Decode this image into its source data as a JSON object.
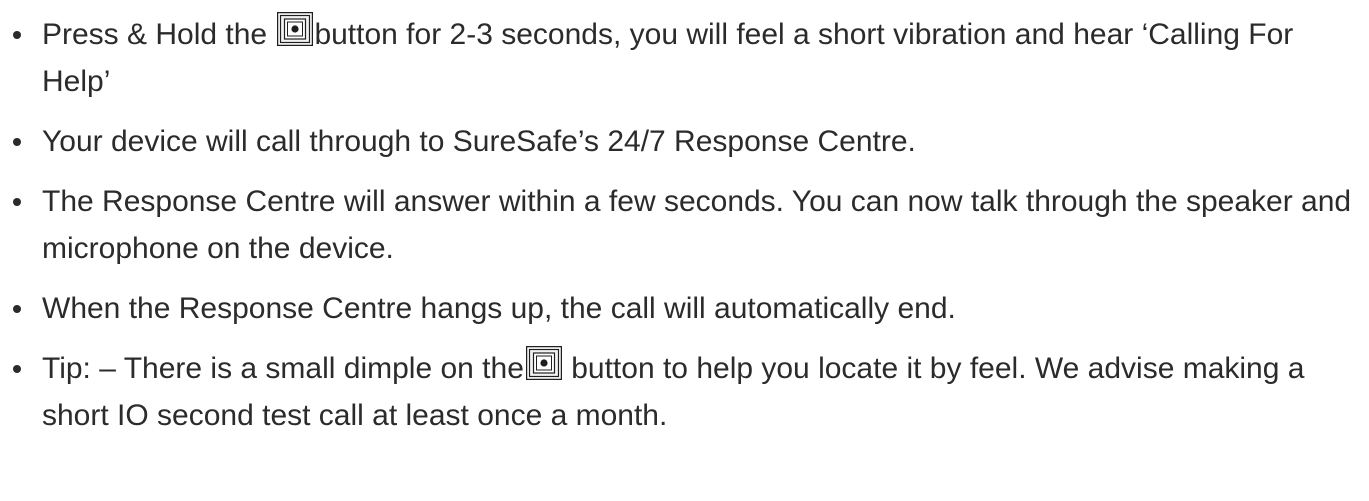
{
  "instructions": {
    "items": [
      {
        "before": "Press & Hold the ",
        "icon": "square-button-icon",
        "after": "button for 2-3 seconds, you will feel a short vibration and hear ‘Calling For Help’"
      },
      {
        "text": "Your device will call through to SureSafe’s 24/7 Response Centre."
      },
      {
        "text": "The Response Centre will answer within a few seconds. You can now talk through the speaker and microphone on the device."
      },
      {
        "text": "When the Response Centre hangs up, the call will automatically end."
      },
      {
        "before": "Tip: – There is a small dimple on the",
        "icon": "square-button-icon",
        "after": " button to help you locate it by feel. We advise making a short IO second test call at least once a month."
      }
    ]
  }
}
